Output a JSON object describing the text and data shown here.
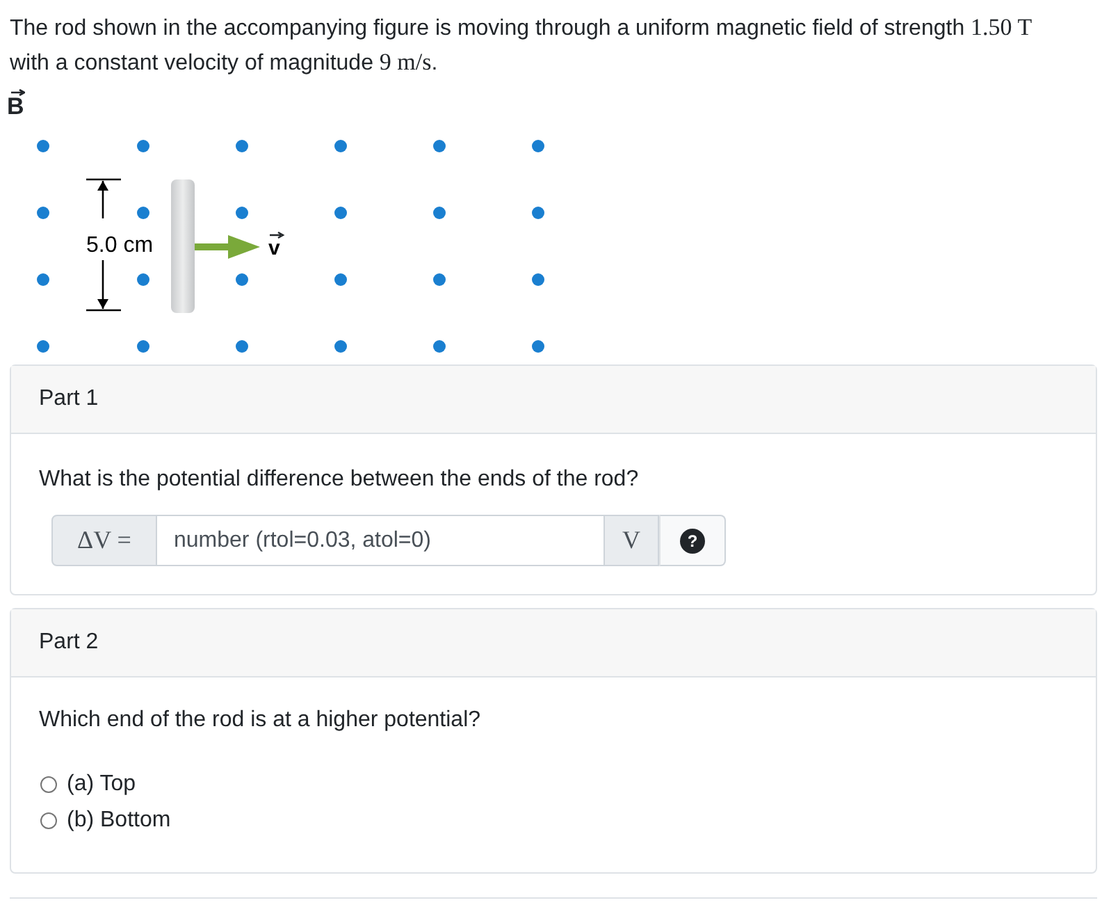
{
  "intro": [
    {
      "kind": "text",
      "text": "The rod shown in the accompanying figure is moving through a uniform magnetic field of strength "
    },
    {
      "kind": "math",
      "text": "1.50 T"
    },
    {
      "kind": "text",
      "text": " with a constant velocity of magnitude "
    },
    {
      "kind": "math",
      "text": "9 m/s"
    },
    {
      "kind": "text",
      "text": "."
    }
  ],
  "figure": {
    "field_label": "B",
    "length_label": "5.0 cm",
    "velocity_label": "v"
  },
  "parts": [
    {
      "title": "Part 1",
      "question": "What is the potential difference between the ends of the rod?",
      "kind": "numeric",
      "answer": {
        "prefix": "ΔV =",
        "placeholder": "number (rtol=0.03, atol=0)",
        "unit": "V",
        "help": "?"
      }
    },
    {
      "title": "Part 2",
      "question": "Which end of the rod is at a higher potential?",
      "kind": "choice",
      "options": [
        {
          "label": "(a) Top",
          "selected": false
        },
        {
          "label": "(b) Bottom",
          "selected": false
        }
      ]
    }
  ]
}
